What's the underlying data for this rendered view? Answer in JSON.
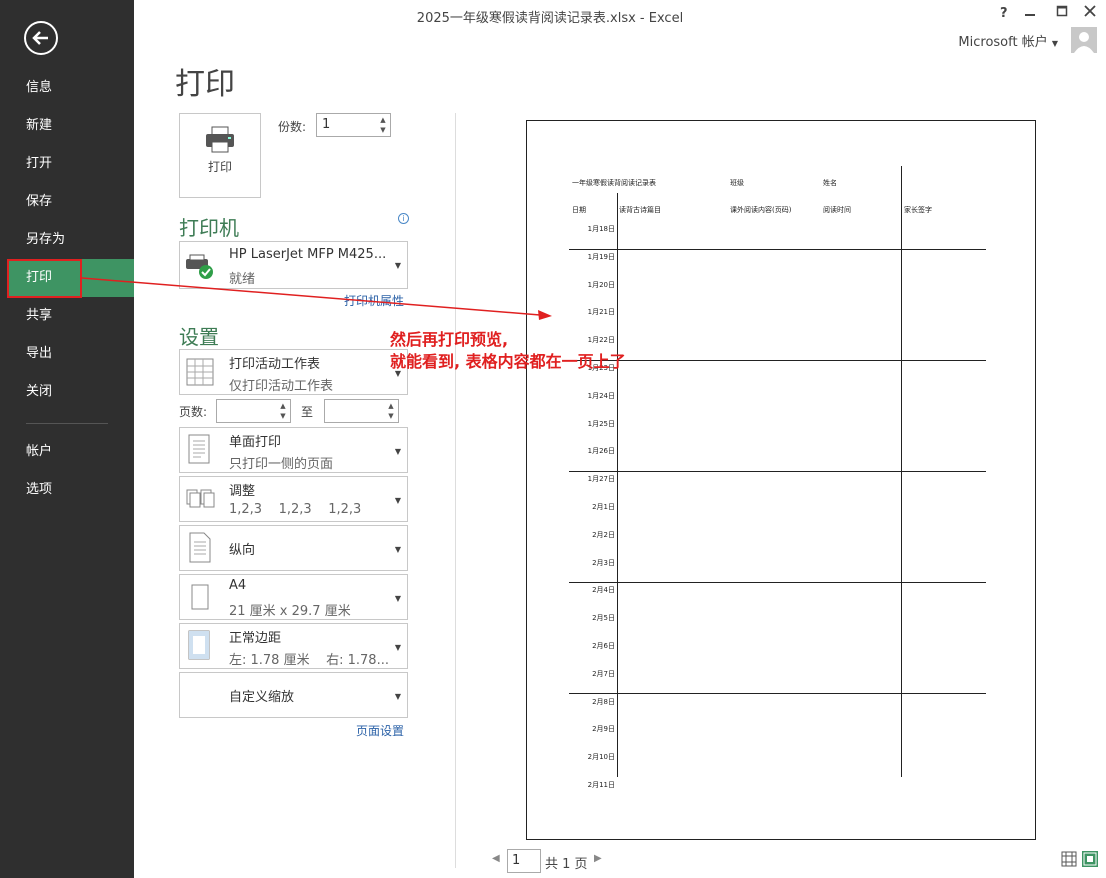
{
  "window": {
    "title": "2025一年级寒假读背阅读记录表.xlsx - Excel",
    "help": "?",
    "account_label": "Microsoft 帐户"
  },
  "nav": {
    "items": [
      "信息",
      "新建",
      "打开",
      "保存",
      "另存为",
      "打印",
      "共享",
      "导出",
      "关闭"
    ],
    "bottom": [
      "帐户",
      "选项"
    ],
    "active": "打印"
  },
  "print": {
    "page_title": "打印",
    "print_button": "打印",
    "copies_label": "份数:",
    "copies_value": "1",
    "printer_heading": "打印机",
    "printer_name": "HP LaserJet MFP M425...",
    "printer_status": "就绪",
    "printer_props": "打印机属性",
    "settings_heading": "设置",
    "settings": [
      {
        "line1": "打印活动工作表",
        "line2": "仅打印活动工作表"
      },
      {
        "line1": "单面打印",
        "line2": "只打印一侧的页面"
      },
      {
        "line1": "调整",
        "line2": "1,2,3    1,2,3    1,2,3"
      },
      {
        "line1": "纵向",
        "line2": ""
      },
      {
        "line1": "A4",
        "line2": "21 厘米 x 29.7 厘米"
      },
      {
        "line1": "正常边距",
        "line2": "左: 1.78 厘米    右: 1.78..."
      },
      {
        "line1": "自定义缩放",
        "line2": ""
      }
    ],
    "pages_label": "页数:",
    "to_label": "至",
    "page_setup": "页面设置"
  },
  "preview": {
    "sheet_title": "一年级寒假读背阅读记录表",
    "class_label": "班级",
    "name_label": "姓名",
    "columns": [
      "日期",
      "读背古诗篇目",
      "课外阅读内容(页码)",
      "阅读时间",
      "家长签字"
    ],
    "dates": [
      "1月18日",
      "1月19日",
      "1月20日",
      "1月21日",
      "1月22日",
      "1月23日",
      "1月24日",
      "1月25日",
      "1月26日",
      "1月27日",
      "2月1日",
      "2月2日",
      "2月3日",
      "2月4日",
      "2月5日",
      "2月6日",
      "2月7日",
      "2月8日",
      "2月9日",
      "2月10日",
      "2月11日"
    ]
  },
  "annotation": {
    "line1": "然后再打印预览,",
    "line2": "就能看到, 表格内容都在一页上了"
  },
  "footer": {
    "page_value": "1",
    "total_text": "共 1 页"
  },
  "colors": {
    "accent": "#3e9463",
    "annotation": "#e02020",
    "sidebar": "#2f2f2f"
  }
}
